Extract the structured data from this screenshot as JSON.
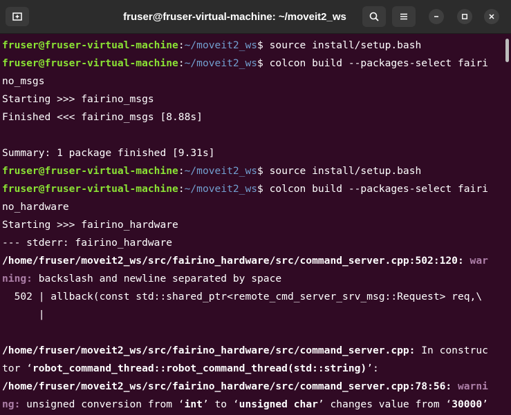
{
  "window": {
    "title": "fruser@fruser-virtual-machine: ~/moveit2_ws"
  },
  "icons": {
    "new_tab": "new-tab-icon",
    "search": "search-icon",
    "menu": "hamburger-menu-icon",
    "minimize": "minimize-icon",
    "maximize": "maximize-icon",
    "close": "close-icon"
  },
  "colors": {
    "background": "#300a24",
    "user_host": "#8ae234",
    "path": "#729fcf",
    "warning": "#ad7fa8",
    "text": "#ffffff"
  },
  "prompt": {
    "user_host": "fruser@fruser-virtual-machine",
    "colon": ":",
    "path": "~/moveit2_ws",
    "dollar": "$"
  },
  "terminal": {
    "lines": [
      "fruser@fruser-virtual-machine:~/moveit2_ws$ source install/setup.bash",
      "fruser@fruser-virtual-machine:~/moveit2_ws$ colcon build --packages-select fairi",
      "no_msgs",
      "Starting >>> fairino_msgs",
      "Finished <<< fairino_msgs [8.88s]",
      "",
      "Summary: 1 package finished [9.31s]",
      "fruser@fruser-virtual-machine:~/moveit2_ws$ source install/setup.bash",
      "fruser@fruser-virtual-machine:~/moveit2_ws$ colcon build --packages-select fairi",
      "no_hardware",
      "Starting >>> fairino_hardware",
      "--- stderr: fairino_hardware",
      "/home/fruser/moveit2_ws/src/fairino_hardware/src/command_server.cpp:502:120: war",
      "ning: backslash and newline separated by space",
      "  502 | allback(const std::shared_ptr<remote_cmd_server_srv_msg::Request> req,\\",
      "      |",
      "",
      "/home/fruser/moveit2_ws/src/fairino_hardware/src/command_server.cpp: In construc",
      "tor ‘robot_command_thread::robot_command_thread(std::string)’:",
      "/home/fruser/moveit2_ws/src/fairino_hardware/src/command_server.cpp:78:56: warni",
      "ng: unsigned conversion from ‘int’ to ‘unsigned char’ changes value from ‘30000’"
    ],
    "commands": {
      "source": " source install/setup.bash",
      "colcon": " colcon build --packages-select fairi"
    },
    "text": {
      "l2": "no_msgs",
      "l3": "Starting >>> fairino_msgs",
      "l4": "Finished <<< fairino_msgs [8.88s]",
      "l6": "Summary: 1 package finished [9.31s]",
      "l9": "no_hardware",
      "l10": "Starting >>> fairino_hardware",
      "l11": "--- stderr: fairino_hardware",
      "l12_path": "/home/fruser/moveit2_ws/src/fairino_hardware/src/command_server.cpp:502:120: ",
      "l12_war": "war",
      "l13_ning": "ning:",
      "l13_rest": " backslash and newline separated by space",
      "l14": "  502 | allback(const std::shared_ptr<remote_cmd_server_srv_msg::Request> req,\\",
      "l15": "      |",
      "l17_path": "/home/fruser/moveit2_ws/src/fairino_hardware/src/command_server.cpp:",
      "l17_rest": " In construc",
      "l18_a": "tor ‘",
      "l18_b": "robot_command_thread::robot_command_thread(std::string)",
      "l18_c": "’:",
      "l19_path": "/home/fruser/moveit2_ws/src/fairino_hardware/src/command_server.cpp:78:56: ",
      "l19_warni": "warni",
      "l20_ng": "ng:",
      "l20_a": " unsigned conversion from ‘",
      "l20_int": "int",
      "l20_b": "’ to ‘",
      "l20_uchar": "unsigned char",
      "l20_c": "’ changes value from ‘",
      "l20_num": "30000",
      "l20_d": "’"
    }
  }
}
